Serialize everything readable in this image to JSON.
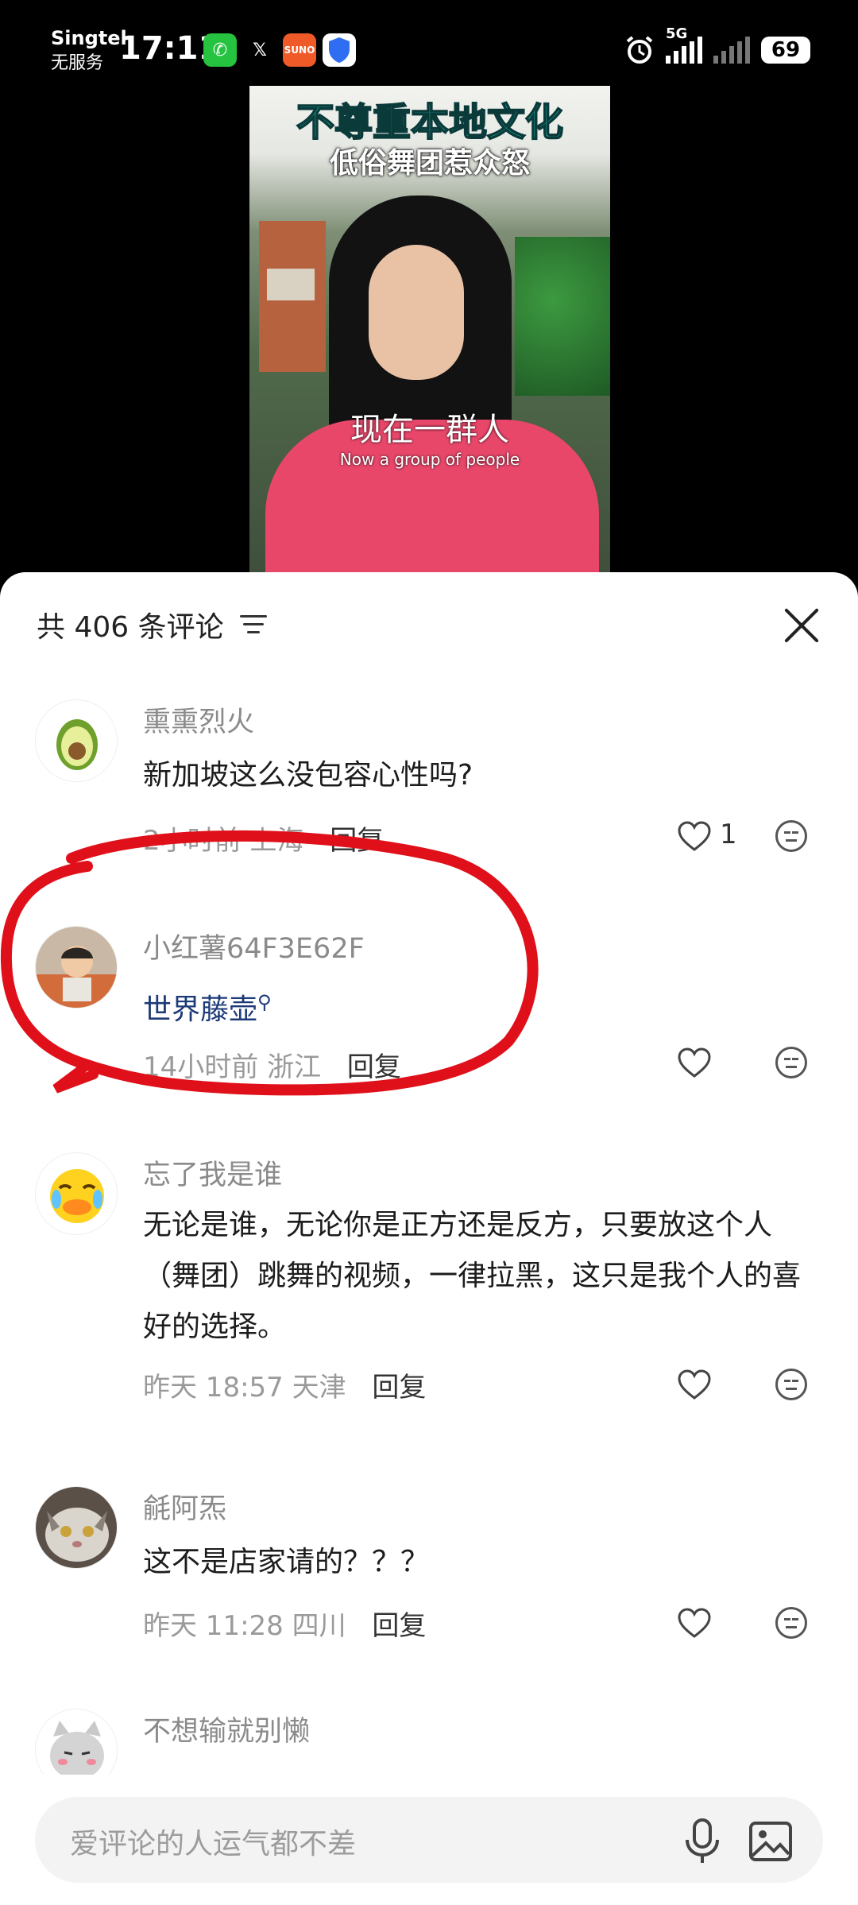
{
  "status_bar": {
    "carrier": "Singtel",
    "carrier_status": "无服务",
    "time": "17:11",
    "network": "5G",
    "battery": "69",
    "icons": [
      "whatsapp-icon",
      "x-icon",
      "suno-icon",
      "shield-icon",
      "alarm-icon",
      "signal-icon"
    ]
  },
  "video": {
    "title": "不尊重本地文化",
    "subtitle": "低俗舞团惹众怒",
    "caption_cn": "现在一群人",
    "caption_en": "Now a group of people"
  },
  "comments_header": {
    "count_label": "共 406 条评论"
  },
  "comments": [
    {
      "username": "熏熏烈火",
      "text": "新加坡这么没包容心性吗?",
      "time": "2小时前",
      "location": "上海",
      "reply": "回复",
      "likes": "1",
      "avatar": "avocado-avatar"
    },
    {
      "username": "小红薯64F3E62F",
      "text": "世界藤壶",
      "time": "14小时前",
      "location": "浙江",
      "reply": "回复",
      "likes": "",
      "avatar": "child-photo-avatar"
    },
    {
      "username": "忘了我是谁",
      "text": "无论是谁，无论你是正方还是反方，只要放这个人（舞团）跳舞的视频，一律拉黑，这只是我个人的喜好的选择。",
      "time": "昨天 18:57",
      "location": "天津",
      "reply": "回复",
      "likes": "",
      "avatar": "crying-duck-avatar"
    },
    {
      "username": "毹阿炁",
      "text": "这不是店家请的？？？",
      "time": "昨天 11:28",
      "location": "四川",
      "reply": "回复",
      "likes": "",
      "avatar": "cat-photo-avatar"
    },
    {
      "username": "不想输就别懒",
      "text": "",
      "time": "",
      "location": "",
      "reply": "",
      "likes": "",
      "avatar": "cartoon-cat-avatar"
    }
  ],
  "input": {
    "placeholder": "爱评论的人运气都不差"
  },
  "colors": {
    "annotation_circle": "#e0101a",
    "video_title": "#29e8d4",
    "link_text": "#1d3a78"
  }
}
